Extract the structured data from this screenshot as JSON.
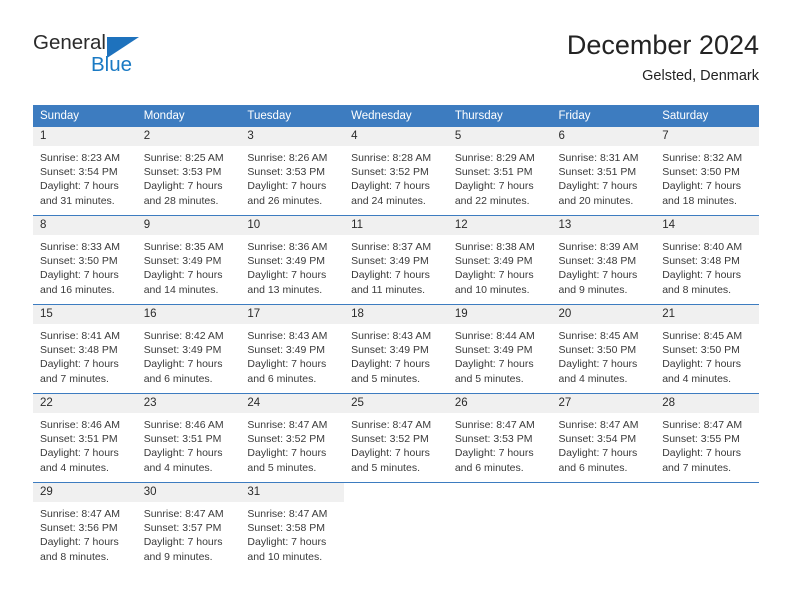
{
  "branding": {
    "name_part1": "General",
    "name_part2": "Blue",
    "triangle_icon": "triangle-logo-icon"
  },
  "header": {
    "title": "December 2024",
    "location": "Gelsted, Denmark"
  },
  "weekday_headers": [
    "Sunday",
    "Monday",
    "Tuesday",
    "Wednesday",
    "Thursday",
    "Friday",
    "Saturday"
  ],
  "colors": {
    "header_blue": "#3d7cc0",
    "logo_blue": "#1a7ac4",
    "daynum_band": "#f0f0f0",
    "text": "#3a3a3a"
  },
  "weeks": [
    [
      {
        "day": "1",
        "sunrise": "Sunrise: 8:23 AM",
        "sunset": "Sunset: 3:54 PM",
        "daylight1": "Daylight: 7 hours",
        "daylight2": "and 31 minutes."
      },
      {
        "day": "2",
        "sunrise": "Sunrise: 8:25 AM",
        "sunset": "Sunset: 3:53 PM",
        "daylight1": "Daylight: 7 hours",
        "daylight2": "and 28 minutes."
      },
      {
        "day": "3",
        "sunrise": "Sunrise: 8:26 AM",
        "sunset": "Sunset: 3:53 PM",
        "daylight1": "Daylight: 7 hours",
        "daylight2": "and 26 minutes."
      },
      {
        "day": "4",
        "sunrise": "Sunrise: 8:28 AM",
        "sunset": "Sunset: 3:52 PM",
        "daylight1": "Daylight: 7 hours",
        "daylight2": "and 24 minutes."
      },
      {
        "day": "5",
        "sunrise": "Sunrise: 8:29 AM",
        "sunset": "Sunset: 3:51 PM",
        "daylight1": "Daylight: 7 hours",
        "daylight2": "and 22 minutes."
      },
      {
        "day": "6",
        "sunrise": "Sunrise: 8:31 AM",
        "sunset": "Sunset: 3:51 PM",
        "daylight1": "Daylight: 7 hours",
        "daylight2": "and 20 minutes."
      },
      {
        "day": "7",
        "sunrise": "Sunrise: 8:32 AM",
        "sunset": "Sunset: 3:50 PM",
        "daylight1": "Daylight: 7 hours",
        "daylight2": "and 18 minutes."
      }
    ],
    [
      {
        "day": "8",
        "sunrise": "Sunrise: 8:33 AM",
        "sunset": "Sunset: 3:50 PM",
        "daylight1": "Daylight: 7 hours",
        "daylight2": "and 16 minutes."
      },
      {
        "day": "9",
        "sunrise": "Sunrise: 8:35 AM",
        "sunset": "Sunset: 3:49 PM",
        "daylight1": "Daylight: 7 hours",
        "daylight2": "and 14 minutes."
      },
      {
        "day": "10",
        "sunrise": "Sunrise: 8:36 AM",
        "sunset": "Sunset: 3:49 PM",
        "daylight1": "Daylight: 7 hours",
        "daylight2": "and 13 minutes."
      },
      {
        "day": "11",
        "sunrise": "Sunrise: 8:37 AM",
        "sunset": "Sunset: 3:49 PM",
        "daylight1": "Daylight: 7 hours",
        "daylight2": "and 11 minutes."
      },
      {
        "day": "12",
        "sunrise": "Sunrise: 8:38 AM",
        "sunset": "Sunset: 3:49 PM",
        "daylight1": "Daylight: 7 hours",
        "daylight2": "and 10 minutes."
      },
      {
        "day": "13",
        "sunrise": "Sunrise: 8:39 AM",
        "sunset": "Sunset: 3:48 PM",
        "daylight1": "Daylight: 7 hours",
        "daylight2": "and 9 minutes."
      },
      {
        "day": "14",
        "sunrise": "Sunrise: 8:40 AM",
        "sunset": "Sunset: 3:48 PM",
        "daylight1": "Daylight: 7 hours",
        "daylight2": "and 8 minutes."
      }
    ],
    [
      {
        "day": "15",
        "sunrise": "Sunrise: 8:41 AM",
        "sunset": "Sunset: 3:48 PM",
        "daylight1": "Daylight: 7 hours",
        "daylight2": "and 7 minutes."
      },
      {
        "day": "16",
        "sunrise": "Sunrise: 8:42 AM",
        "sunset": "Sunset: 3:49 PM",
        "daylight1": "Daylight: 7 hours",
        "daylight2": "and 6 minutes."
      },
      {
        "day": "17",
        "sunrise": "Sunrise: 8:43 AM",
        "sunset": "Sunset: 3:49 PM",
        "daylight1": "Daylight: 7 hours",
        "daylight2": "and 6 minutes."
      },
      {
        "day": "18",
        "sunrise": "Sunrise: 8:43 AM",
        "sunset": "Sunset: 3:49 PM",
        "daylight1": "Daylight: 7 hours",
        "daylight2": "and 5 minutes."
      },
      {
        "day": "19",
        "sunrise": "Sunrise: 8:44 AM",
        "sunset": "Sunset: 3:49 PM",
        "daylight1": "Daylight: 7 hours",
        "daylight2": "and 5 minutes."
      },
      {
        "day": "20",
        "sunrise": "Sunrise: 8:45 AM",
        "sunset": "Sunset: 3:50 PM",
        "daylight1": "Daylight: 7 hours",
        "daylight2": "and 4 minutes."
      },
      {
        "day": "21",
        "sunrise": "Sunrise: 8:45 AM",
        "sunset": "Sunset: 3:50 PM",
        "daylight1": "Daylight: 7 hours",
        "daylight2": "and 4 minutes."
      }
    ],
    [
      {
        "day": "22",
        "sunrise": "Sunrise: 8:46 AM",
        "sunset": "Sunset: 3:51 PM",
        "daylight1": "Daylight: 7 hours",
        "daylight2": "and 4 minutes."
      },
      {
        "day": "23",
        "sunrise": "Sunrise: 8:46 AM",
        "sunset": "Sunset: 3:51 PM",
        "daylight1": "Daylight: 7 hours",
        "daylight2": "and 4 minutes."
      },
      {
        "day": "24",
        "sunrise": "Sunrise: 8:47 AM",
        "sunset": "Sunset: 3:52 PM",
        "daylight1": "Daylight: 7 hours",
        "daylight2": "and 5 minutes."
      },
      {
        "day": "25",
        "sunrise": "Sunrise: 8:47 AM",
        "sunset": "Sunset: 3:52 PM",
        "daylight1": "Daylight: 7 hours",
        "daylight2": "and 5 minutes."
      },
      {
        "day": "26",
        "sunrise": "Sunrise: 8:47 AM",
        "sunset": "Sunset: 3:53 PM",
        "daylight1": "Daylight: 7 hours",
        "daylight2": "and 6 minutes."
      },
      {
        "day": "27",
        "sunrise": "Sunrise: 8:47 AM",
        "sunset": "Sunset: 3:54 PM",
        "daylight1": "Daylight: 7 hours",
        "daylight2": "and 6 minutes."
      },
      {
        "day": "28",
        "sunrise": "Sunrise: 8:47 AM",
        "sunset": "Sunset: 3:55 PM",
        "daylight1": "Daylight: 7 hours",
        "daylight2": "and 7 minutes."
      }
    ],
    [
      {
        "day": "29",
        "sunrise": "Sunrise: 8:47 AM",
        "sunset": "Sunset: 3:56 PM",
        "daylight1": "Daylight: 7 hours",
        "daylight2": "and 8 minutes."
      },
      {
        "day": "30",
        "sunrise": "Sunrise: 8:47 AM",
        "sunset": "Sunset: 3:57 PM",
        "daylight1": "Daylight: 7 hours",
        "daylight2": "and 9 minutes."
      },
      {
        "day": "31",
        "sunrise": "Sunrise: 8:47 AM",
        "sunset": "Sunset: 3:58 PM",
        "daylight1": "Daylight: 7 hours",
        "daylight2": "and 10 minutes."
      },
      {
        "day": "",
        "sunrise": "",
        "sunset": "",
        "daylight1": "",
        "daylight2": ""
      },
      {
        "day": "",
        "sunrise": "",
        "sunset": "",
        "daylight1": "",
        "daylight2": ""
      },
      {
        "day": "",
        "sunrise": "",
        "sunset": "",
        "daylight1": "",
        "daylight2": ""
      },
      {
        "day": "",
        "sunrise": "",
        "sunset": "",
        "daylight1": "",
        "daylight2": ""
      }
    ]
  ]
}
